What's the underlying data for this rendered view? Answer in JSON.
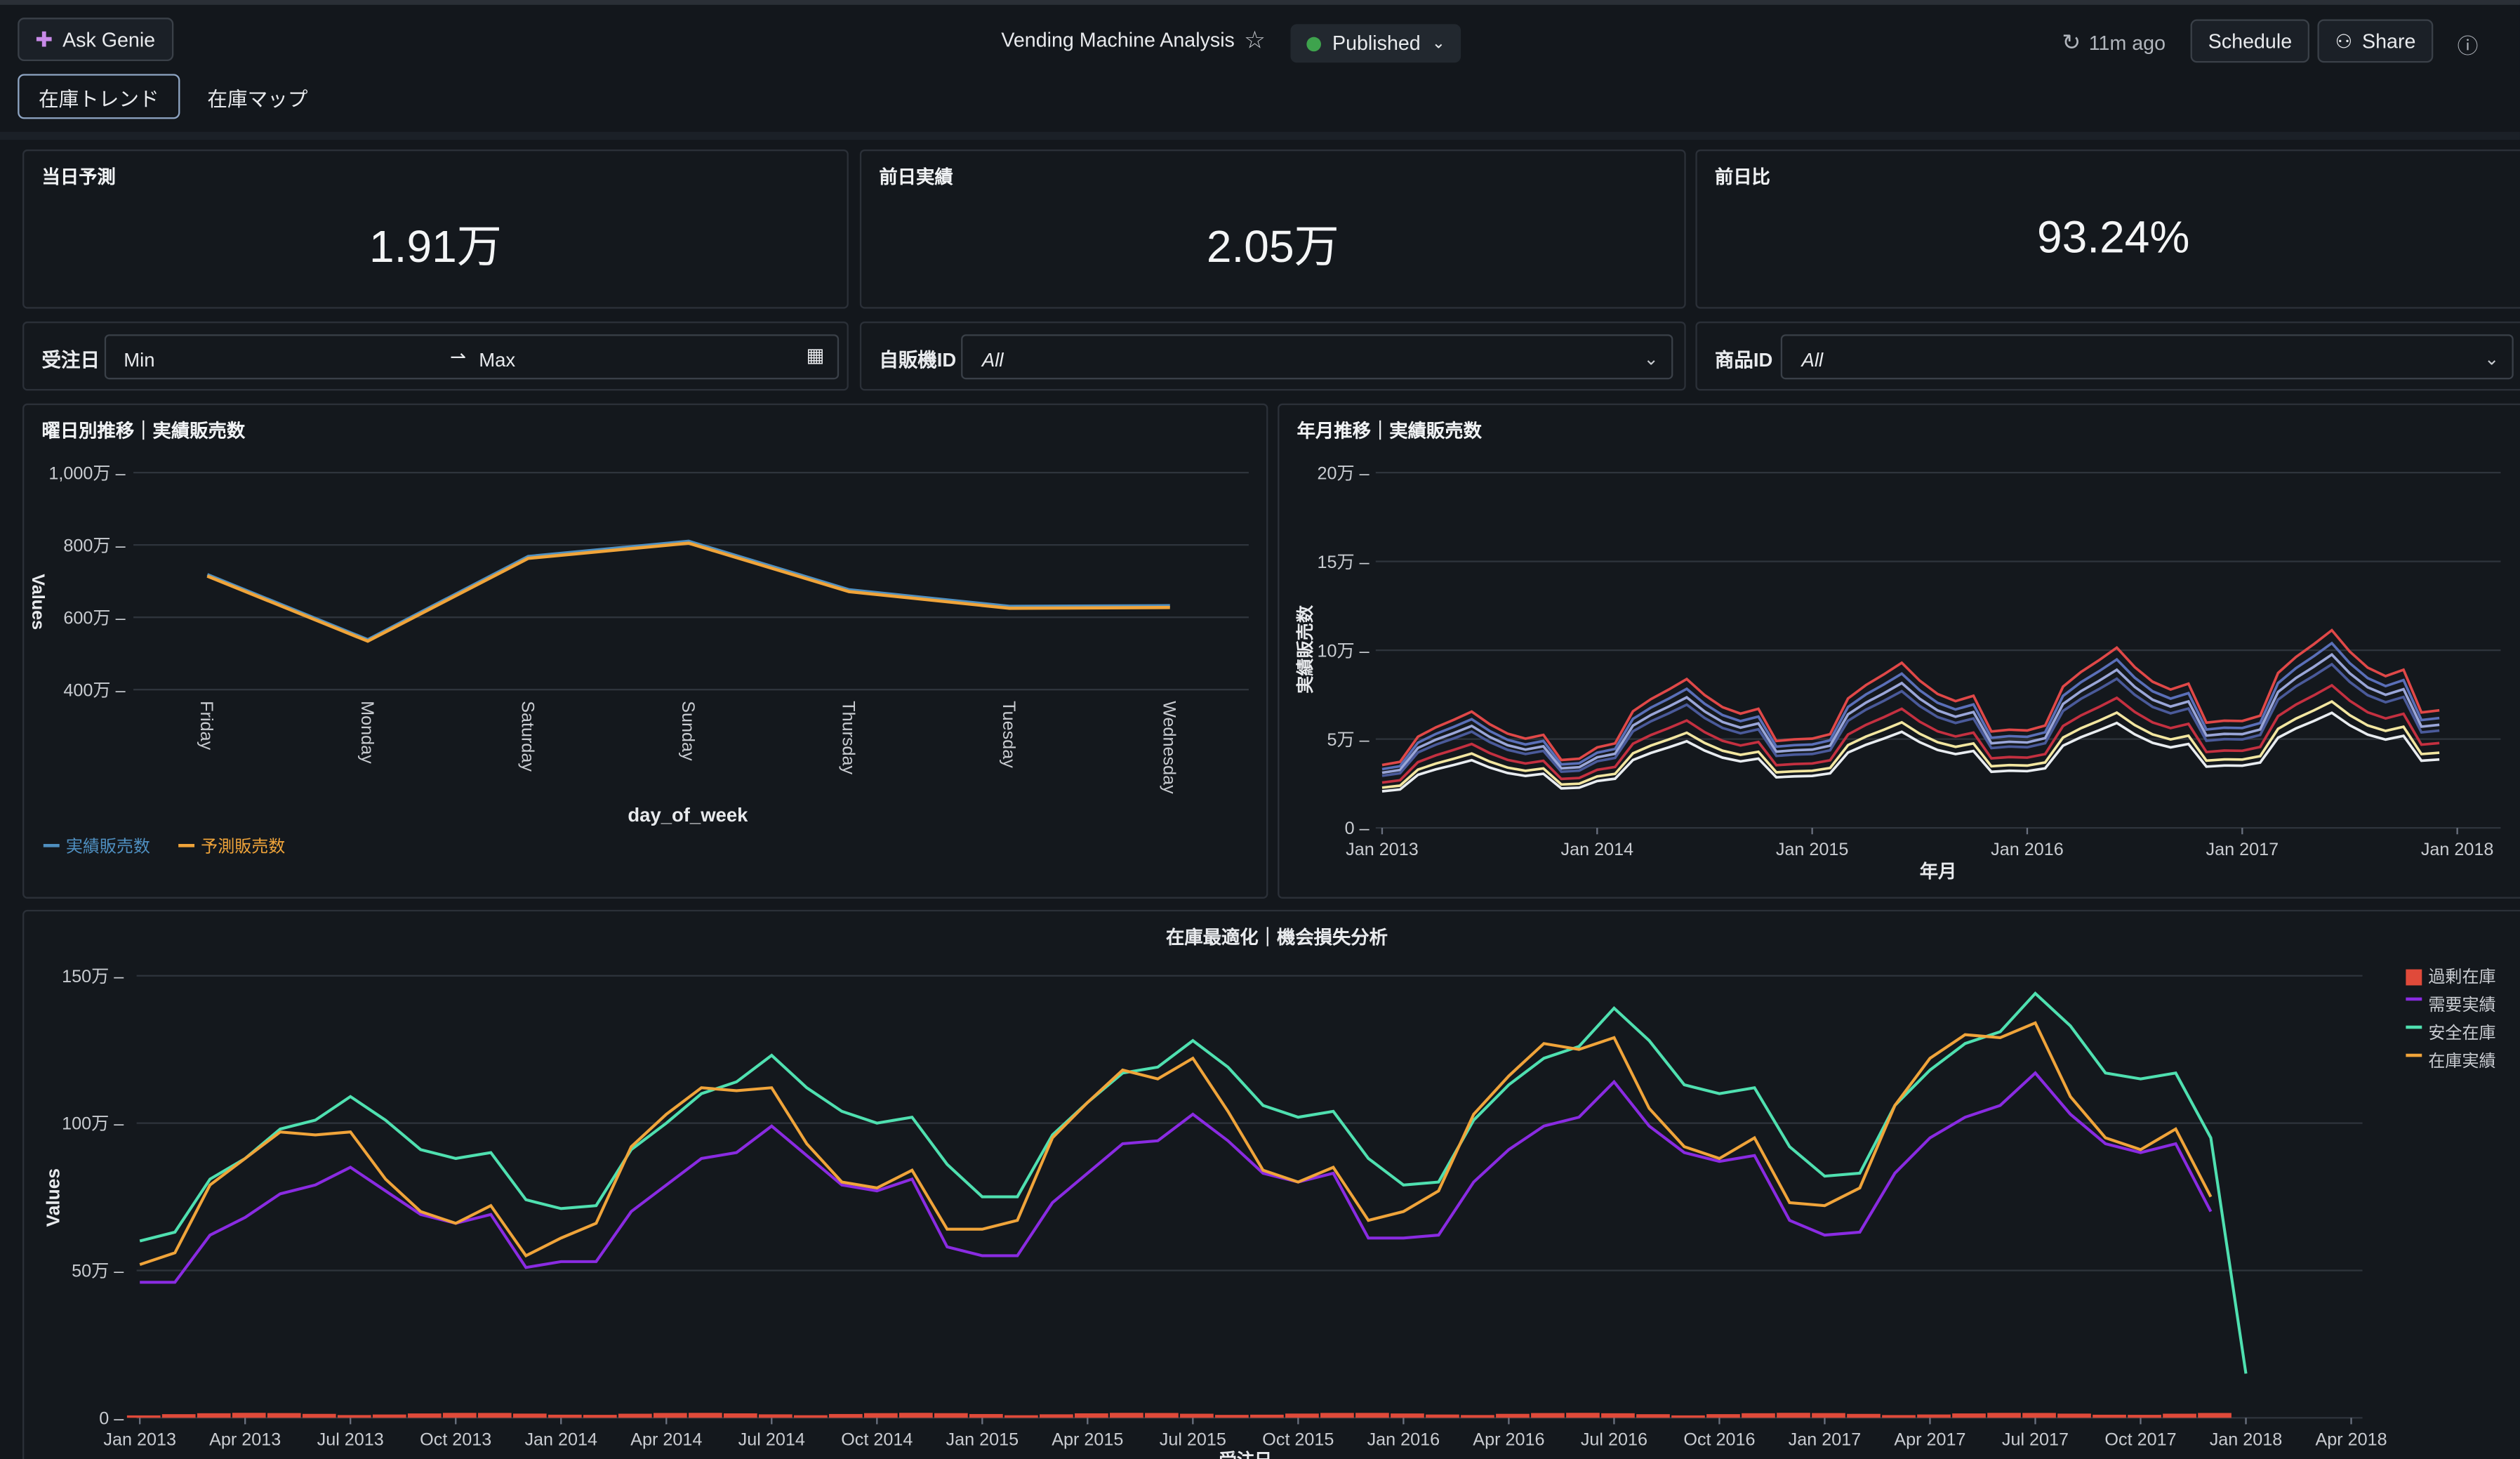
{
  "header": {
    "ask_genie": "Ask Genie",
    "title": "Vending Machine Analysis",
    "status": "Published",
    "refresh": "11m ago",
    "schedule": "Schedule",
    "share": "Share",
    "status_color": "#3ea34d"
  },
  "tabs": [
    {
      "label": "在庫トレンド",
      "active": true
    },
    {
      "label": "在庫マップ",
      "active": false
    }
  ],
  "kpis": [
    {
      "title": "当日予測",
      "value": "1.91万"
    },
    {
      "title": "前日実績",
      "value": "2.05万"
    },
    {
      "title": "前日比",
      "value": "93.24%"
    }
  ],
  "filters": {
    "date": {
      "label": "受注日",
      "min": "Min",
      "max": "Max"
    },
    "machine": {
      "label": "自販機ID",
      "value": "All"
    },
    "product": {
      "label": "商品ID",
      "value": "All"
    }
  },
  "chart_data": [
    {
      "title": "曜日別推移｜実績販売数",
      "type": "line",
      "xlabel": "day_of_week",
      "ylabel": "Values",
      "categories": [
        "Friday",
        "Monday",
        "Saturday",
        "Sunday",
        "Thursday",
        "Tuesday",
        "Wednesday"
      ],
      "yticks": [
        "400万",
        "600万",
        "800万",
        "1,000万"
      ],
      "ylim": [
        400,
        1000
      ],
      "series": [
        {
          "name": "実績販売数",
          "color": "#4f8fc0",
          "values": [
            718,
            538,
            768,
            810,
            676,
            630,
            632
          ]
        },
        {
          "name": "予測販売数",
          "color": "#f0a43a",
          "values": [
            714,
            534,
            763,
            805,
            671,
            625,
            627
          ]
        }
      ],
      "legend": "bottom-left"
    },
    {
      "title": "年月推移｜実績販売数",
      "type": "line",
      "xlabel": "年月",
      "ylabel": "実績販売数",
      "xticks": [
        "Jan 2013",
        "Jan 2014",
        "Jan 2015",
        "Jan 2016",
        "Jan 2017",
        "Jan 2018"
      ],
      "yticks": [
        "0",
        "5万",
        "10万",
        "15万",
        "20万"
      ],
      "ylim": [
        0,
        20
      ],
      "months": 60,
      "base_pattern": [
        1.0,
        1.05,
        1.45,
        1.6,
        1.72,
        1.85,
        1.65,
        1.5,
        1.42,
        1.48,
        1.08,
        1.1
      ],
      "year_growth": [
        0.0,
        0.28,
        0.42,
        0.55,
        0.7
      ],
      "series": [
        {
          "color": "#e04848",
          "scale": 6.1
        },
        {
          "color": "#5a6fb8",
          "scale": 5.7
        },
        {
          "color": "#9aa6d8",
          "scale": 5.35
        },
        {
          "color": "#4a5a9a",
          "scale": 5.05
        },
        {
          "color": "#c43040",
          "scale": 4.4
        },
        {
          "color": "#f2e6a0",
          "scale": 3.9
        },
        {
          "color": "#e8ecf0",
          "scale": 3.55
        }
      ]
    },
    {
      "title": "在庫最適化｜機会損失分析",
      "type": "line",
      "xlabel": "受注日",
      "ylabel": "Values",
      "xticks": [
        "Jan 2013",
        "Apr 2013",
        "Jul 2013",
        "Oct 2013",
        "Jan 2014",
        "Apr 2014",
        "Jul 2014",
        "Oct 2014",
        "Jan 2015",
        "Apr 2015",
        "Jul 2015",
        "Oct 2015",
        "Jan 2016",
        "Apr 2016",
        "Jul 2016",
        "Oct 2016",
        "Jan 2017",
        "Apr 2017",
        "Jul 2017",
        "Oct 2017",
        "Jan 2018",
        "Apr 2018"
      ],
      "yticks": [
        "0",
        "50万",
        "100万",
        "150万"
      ],
      "ylim": [
        0,
        150
      ],
      "legend": "top-right",
      "series": [
        {
          "name": "過剰在庫",
          "color": "#e04a3a",
          "kind": "bar"
        },
        {
          "name": "需要実績",
          "color": "#8a2be2",
          "kind": "line",
          "values": [
            46,
            46,
            62,
            68,
            76,
            79,
            85,
            77,
            69,
            66,
            69,
            51,
            53,
            53,
            70,
            79,
            88,
            90,
            99,
            89,
            79,
            77,
            81,
            58,
            55,
            55,
            73,
            83,
            93,
            94,
            103,
            94,
            83,
            80,
            83,
            61,
            61,
            62,
            80,
            91,
            99,
            102,
            114,
            99,
            90,
            87,
            89,
            67,
            62,
            63,
            83,
            95,
            102,
            106,
            117,
            103,
            93,
            90,
            93,
            70
          ]
        },
        {
          "name": "安全在庫",
          "color": "#4fe0b0",
          "kind": "line",
          "values": [
            60,
            63,
            81,
            88,
            98,
            101,
            109,
            101,
            91,
            88,
            90,
            74,
            71,
            72,
            91,
            100,
            110,
            114,
            123,
            112,
            104,
            100,
            102,
            86,
            75,
            75,
            96,
            107,
            117,
            119,
            128,
            119,
            106,
            102,
            104,
            88,
            79,
            80,
            101,
            113,
            122,
            126,
            139,
            128,
            113,
            110,
            112,
            92,
            82,
            83,
            106,
            118,
            127,
            131,
            144,
            133,
            117,
            115,
            117,
            95,
            15
          ]
        },
        {
          "name": "在庫実績",
          "color": "#f0a43a",
          "kind": "line",
          "values": [
            52,
            56,
            79,
            88,
            97,
            96,
            97,
            81,
            70,
            66,
            72,
            55,
            61,
            66,
            92,
            103,
            112,
            111,
            112,
            93,
            80,
            78,
            84,
            64,
            64,
            67,
            95,
            107,
            118,
            115,
            122,
            104,
            84,
            80,
            85,
            67,
            70,
            77,
            103,
            116,
            127,
            125,
            129,
            105,
            92,
            88,
            95,
            73,
            72,
            78,
            106,
            122,
            130,
            129,
            134,
            109,
            95,
            91,
            98,
            75
          ]
        }
      ]
    }
  ]
}
